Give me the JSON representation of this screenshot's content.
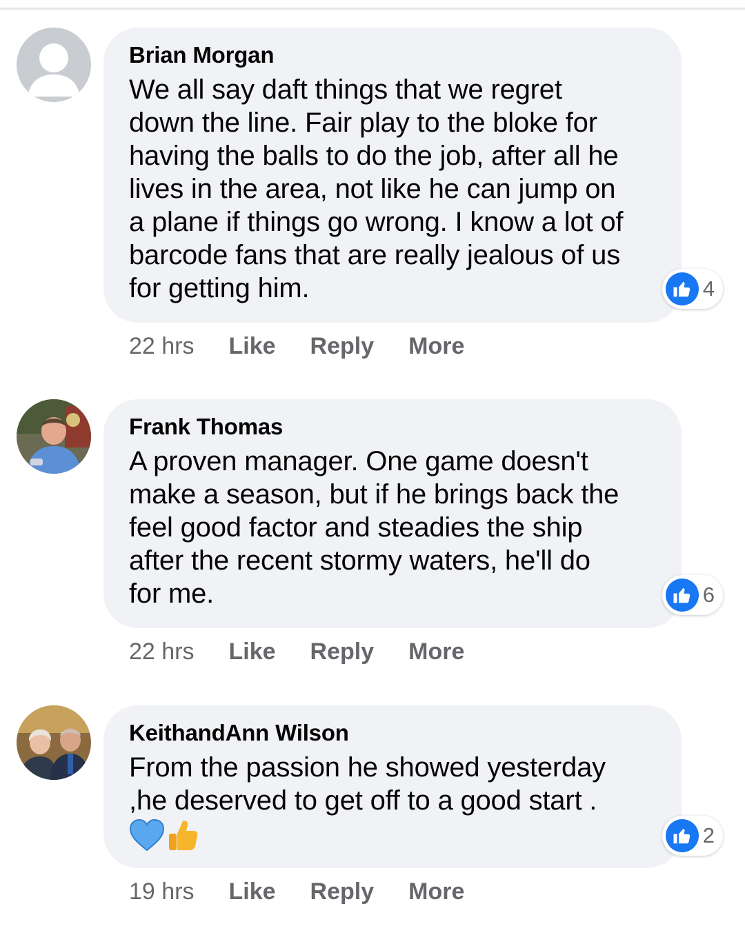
{
  "colors": {
    "bubble": "#f0f2f5",
    "like_blue": "#1877f2",
    "meta_gray": "#65676b",
    "text": "#050505"
  },
  "comments": [
    {
      "author": "Brian Morgan",
      "avatar": "default-avatar-icon",
      "text": "We all say daft things that we regret\ndown the line. Fair play to the bloke for\nhaving the balls to do the job, after all he\nlives in the area, not like he can jump on\na plane if things go wrong. I know a lot of\nbarcode fans that are really jealous of us\nfor getting him.",
      "reaction_icon": "thumbs-up-icon",
      "reaction_count": "4",
      "time": "22 hrs",
      "actions": {
        "like": "Like",
        "reply": "Reply",
        "more": "More"
      }
    },
    {
      "author": "Frank Thomas",
      "avatar": "profile-photo",
      "text": "A proven manager. One game doesn't\nmake a season, but if he brings back the\nfeel good factor and steadies the ship\nafter the recent stormy waters, he'll do\nfor me.",
      "reaction_icon": "thumbs-up-icon",
      "reaction_count": "6",
      "time": "22 hrs",
      "actions": {
        "like": "Like",
        "reply": "Reply",
        "more": "More"
      }
    },
    {
      "author": "KeithandAnn Wilson",
      "avatar": "profile-photo",
      "text": "From the passion he showed yesterday\n,he deserved to get off to a good start .",
      "emojis": [
        "blue-heart-icon",
        "thumbs-up-emoji-icon"
      ],
      "reaction_icon": "thumbs-up-icon",
      "reaction_count": "2",
      "time": "19 hrs",
      "actions": {
        "like": "Like",
        "reply": "Reply",
        "more": "More"
      }
    }
  ]
}
